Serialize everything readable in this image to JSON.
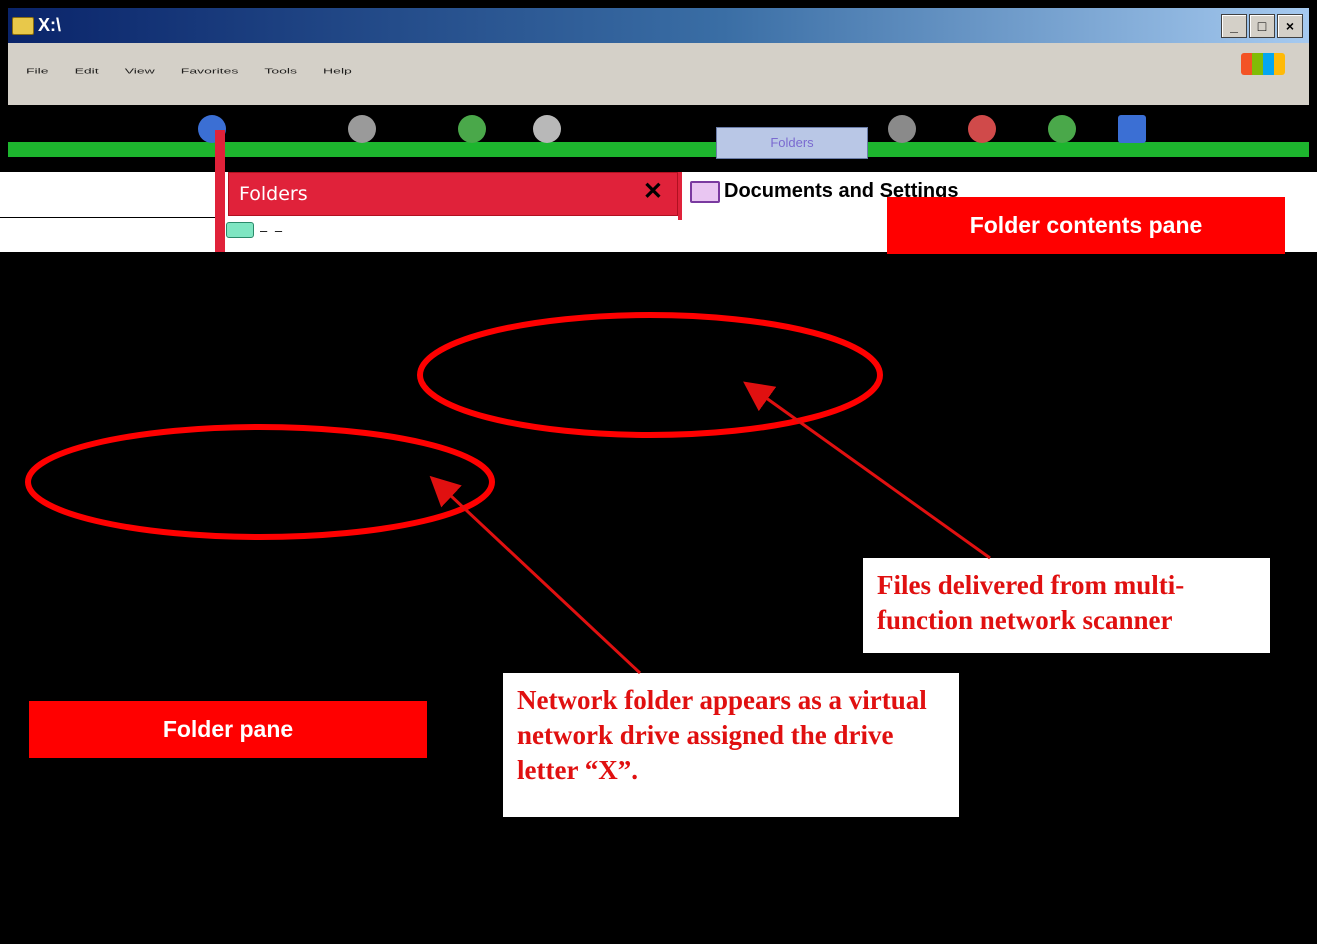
{
  "window": {
    "title": "X:\\",
    "minimize_glyph": "_",
    "maximize_glyph": "□",
    "close_glyph": "×"
  },
  "menu": {
    "items": [
      "File",
      "Edit",
      "View",
      "Favorites",
      "Tools",
      "Help"
    ]
  },
  "toolbar": {
    "folders_label": "Folders"
  },
  "folders_pane": {
    "title": "Folders",
    "close_glyph": "✕",
    "first_item": "– –"
  },
  "contents_pane": {
    "heading": "Documents and Settings"
  },
  "callouts": {
    "contents_pane_label": "Folder contents pane",
    "folder_pane_label": "Folder pane",
    "scanner_note": "Files delivered from multi-function network scanner",
    "drive_note": "Network folder appears as a virtual network drive assigned the drive letter “X”."
  },
  "colors": {
    "callout_red": "#ff0000",
    "ellipse_red": "#ff0000",
    "arrow_red": "#e01010"
  }
}
